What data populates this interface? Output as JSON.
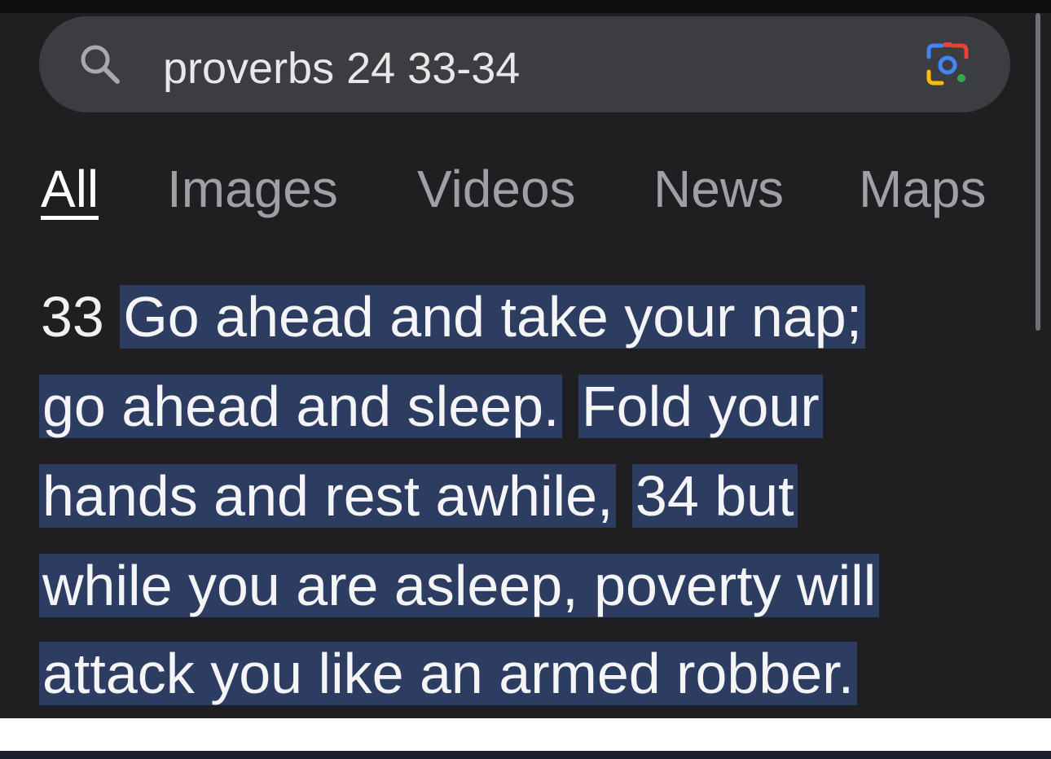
{
  "search": {
    "query": "proverbs 24 33-34",
    "search_icon": "search-icon",
    "lens_icon": "google-lens-icon"
  },
  "tabs": [
    {
      "label": "All",
      "active": true
    },
    {
      "label": "Images",
      "active": false
    },
    {
      "label": "Videos",
      "active": false
    },
    {
      "label": "News",
      "active": false
    },
    {
      "label": "Maps",
      "active": false
    }
  ],
  "result": {
    "verse_33_number": "33",
    "line1": "Go ahead and take your nap;",
    "line2a": "go ahead and sleep.",
    "line2b": "Fold your",
    "line3a": "hands and rest awhile,",
    "line3b": "34 but",
    "line4": "while you are asleep, poverty will",
    "line5": "attack you like an armed robber."
  },
  "colors": {
    "background": "#1f1f21",
    "search_bar": "#3c3d40",
    "highlight": "#2d3d61",
    "active_tab": "#ffffff",
    "inactive_tab": "#9ea0a5"
  }
}
